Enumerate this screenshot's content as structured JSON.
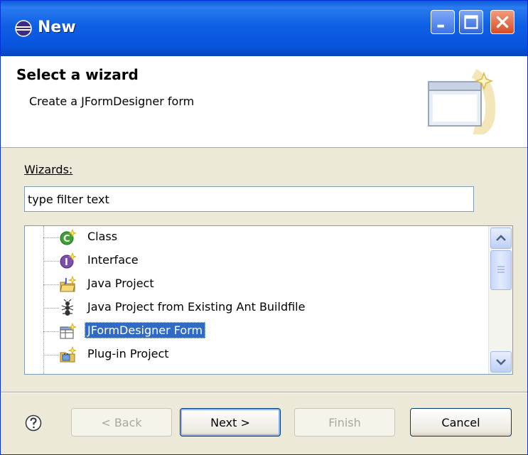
{
  "window": {
    "title": "New"
  },
  "banner": {
    "title": "Select a wizard",
    "description": "Create a JFormDesigner form"
  },
  "wizards": {
    "label": "Wizards:",
    "filter_value": "type filter text"
  },
  "tree": {
    "items": [
      {
        "label": "Class",
        "icon": "class-icon"
      },
      {
        "label": "Interface",
        "icon": "interface-icon"
      },
      {
        "label": "Java Project",
        "icon": "java-project-icon"
      },
      {
        "label": "Java Project from Existing Ant Buildfile",
        "icon": "ant-icon"
      },
      {
        "label": "JFormDesigner Form",
        "icon": "jformdesigner-form-icon",
        "selected": true
      },
      {
        "label": "Plug-in Project",
        "icon": "plugin-project-icon"
      }
    ]
  },
  "buttons": {
    "back": "< Back",
    "next": "Next >",
    "finish": "Finish",
    "cancel": "Cancel"
  },
  "colors": {
    "titlebar": "#0855dd",
    "selection": "#316ac5",
    "window_bg": "#ece9d8"
  }
}
